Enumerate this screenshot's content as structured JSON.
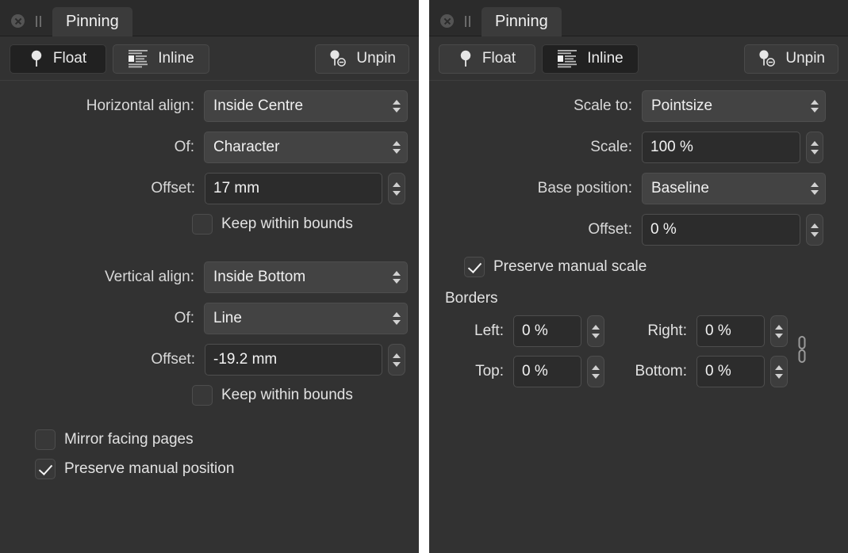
{
  "window": {
    "close_icon": "close-circle-icon",
    "pause_icon": "pause-grip-icon",
    "tab_label": "Pinning"
  },
  "toolbar": {
    "float_label": "Float",
    "float_icon": "pin-float-icon",
    "inline_label": "Inline",
    "inline_icon": "pin-inline-icon",
    "unpin_label": "Unpin",
    "unpin_icon": "unpin-icon"
  },
  "colors": {
    "panel_bg": "#323232",
    "tabbar_bg": "#2b2b2b",
    "tab_active_bg": "#3b3b3b",
    "popup_bg": "#434343",
    "field_bg": "#2c2c2c",
    "text": "#f0f0f0",
    "selected_btn_bg": "#212121"
  },
  "left_panel": {
    "selected_mode": "Float",
    "horizontal_align": {
      "label": "Horizontal align:",
      "value": "Inside Centre"
    },
    "horizontal_of": {
      "label": "Of:",
      "value": "Character"
    },
    "horizontal_offset": {
      "label": "Offset:",
      "value": "17 mm"
    },
    "horizontal_keep": {
      "label": "Keep within bounds",
      "checked": false
    },
    "vertical_align": {
      "label": "Vertical align:",
      "value": "Inside Bottom"
    },
    "vertical_of": {
      "label": "Of:",
      "value": "Line"
    },
    "vertical_offset": {
      "label": "Offset:",
      "value": "-19.2 mm"
    },
    "vertical_keep": {
      "label": "Keep within bounds",
      "checked": false
    },
    "mirror_facing": {
      "label": "Mirror facing pages",
      "checked": false
    },
    "preserve_position": {
      "label": "Preserve manual position",
      "checked": true
    }
  },
  "right_panel": {
    "selected_mode": "Inline",
    "scale_to": {
      "label": "Scale to:",
      "value": "Pointsize"
    },
    "scale": {
      "label": "Scale:",
      "value": "100 %"
    },
    "base_position": {
      "label": "Base position:",
      "value": "Baseline"
    },
    "offset": {
      "label": "Offset:",
      "value": "0 %"
    },
    "preserve_scale": {
      "label": "Preserve manual scale",
      "checked": true
    },
    "borders": {
      "title": "Borders",
      "left": {
        "label": "Left:",
        "value": "0 %"
      },
      "right": {
        "label": "Right:",
        "value": "0 %"
      },
      "top": {
        "label": "Top:",
        "value": "0 %"
      },
      "bottom": {
        "label": "Bottom:",
        "value": "0 %"
      },
      "link_icon": "chain-link-icon"
    }
  }
}
